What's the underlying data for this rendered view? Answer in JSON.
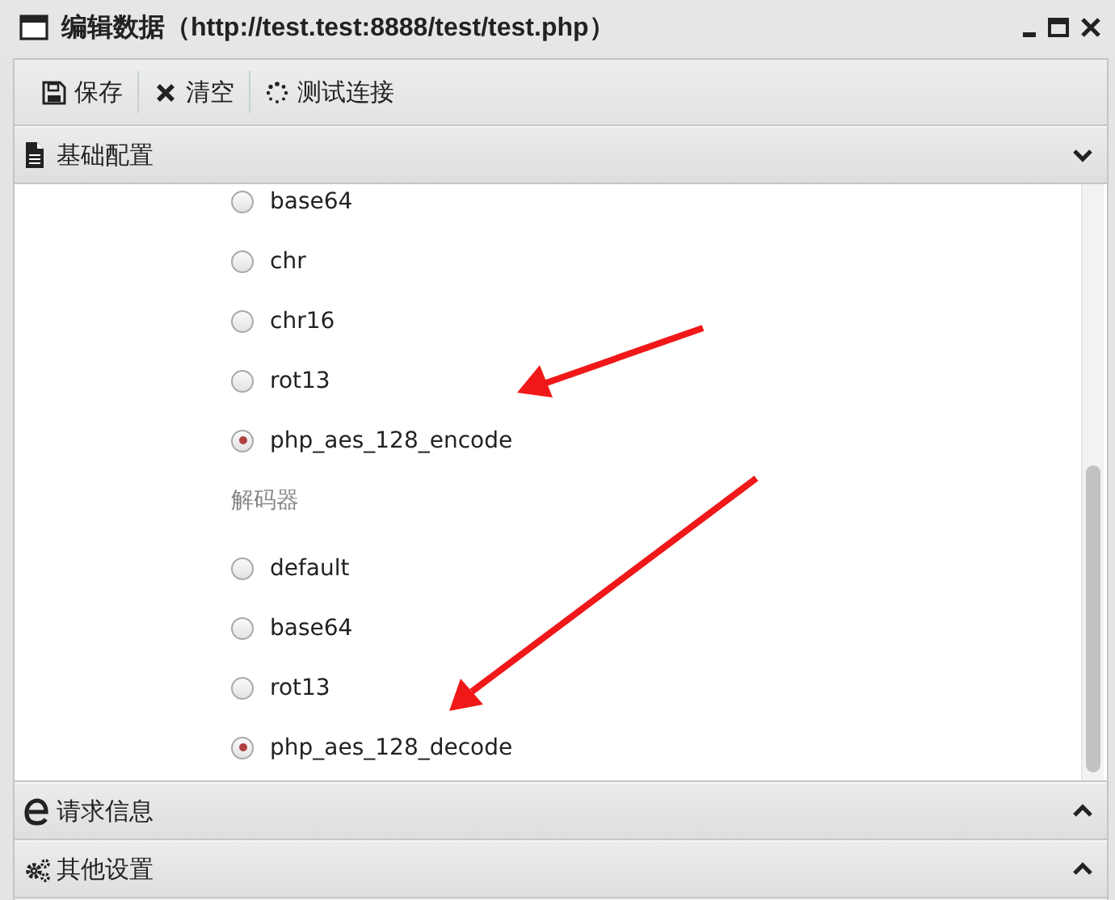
{
  "window": {
    "title": "编辑数据（http://test.test:8888/test/test.php）"
  },
  "toolbar": [
    {
      "label": "保存",
      "kind": "save"
    },
    {
      "label": "清空",
      "kind": "clear"
    },
    {
      "label": "测试连接",
      "kind": "test"
    }
  ],
  "sections": [
    {
      "title": "基础配置",
      "kind": "doc",
      "expanded": true,
      "groups": [
        {
          "options": [
            {
              "label": "base64",
              "selected": false
            },
            {
              "label": "chr",
              "selected": false
            },
            {
              "label": "chr16",
              "selected": false
            },
            {
              "label": "rot13",
              "selected": false
            },
            {
              "label": "php_aes_128_encode",
              "selected": true
            }
          ]
        },
        {
          "label": "解码器",
          "options": [
            {
              "label": "default",
              "selected": false
            },
            {
              "label": "base64",
              "selected": false
            },
            {
              "label": "rot13",
              "selected": false
            },
            {
              "label": "php_aes_128_decode",
              "selected": true
            }
          ]
        }
      ]
    },
    {
      "title": "请求信息",
      "kind": "web",
      "expanded": false
    },
    {
      "title": "其他设置",
      "kind": "gears",
      "expanded": false
    }
  ]
}
